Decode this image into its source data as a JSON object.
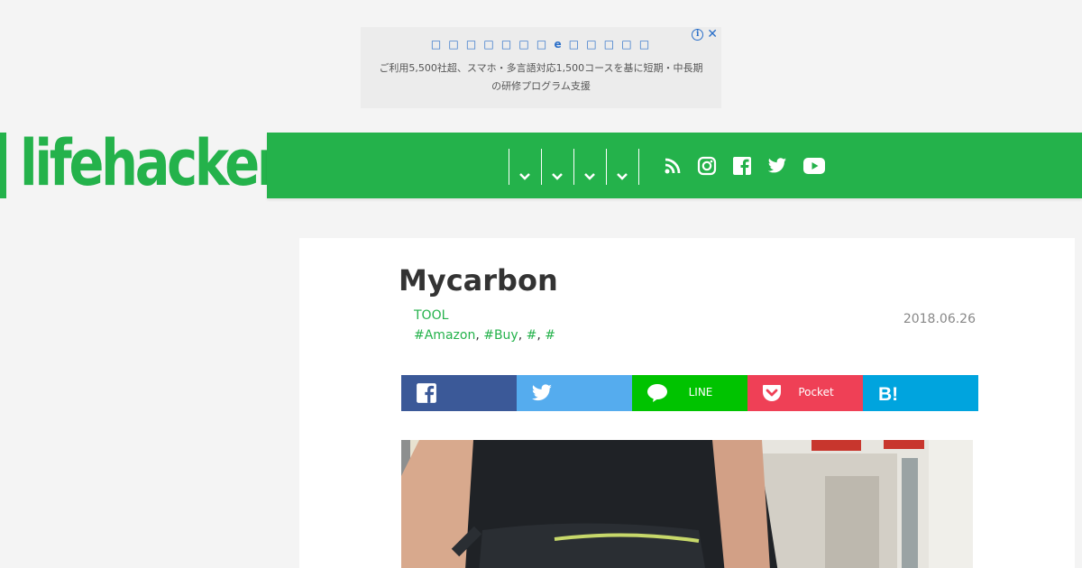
{
  "ad": {
    "title": "□ □ □ □ □ □ □ e □ □ □ □ □",
    "body": "ご利用5,500社超、スマホ・多言語対応1,500コースを基に短期・中長期の研修プログラム支援",
    "info_icon": "info-icon",
    "close_icon": "close-icon"
  },
  "header": {
    "logo_text": "lifehacker",
    "nav_items": [
      "",
      "",
      "",
      ""
    ],
    "social_icons": [
      "rss-icon",
      "instagram-icon",
      "facebook-icon",
      "twitter-icon",
      "youtube-icon"
    ]
  },
  "article": {
    "title": "Mycarbon",
    "category": "TOOL",
    "tags": [
      "#Amazon",
      "#Buy",
      "#",
      "#"
    ],
    "tag_separator": ",",
    "date": "2018.06.26",
    "share": {
      "facebook": "",
      "twitter": "",
      "line": "LINE",
      "pocket": "Pocket",
      "hatena": ""
    }
  },
  "colors": {
    "brand_green": "#24b24b",
    "facebook": "#3b5998",
    "twitter": "#55acee",
    "line": "#00c300",
    "pocket": "#ef4056",
    "hatena": "#00a4de"
  }
}
